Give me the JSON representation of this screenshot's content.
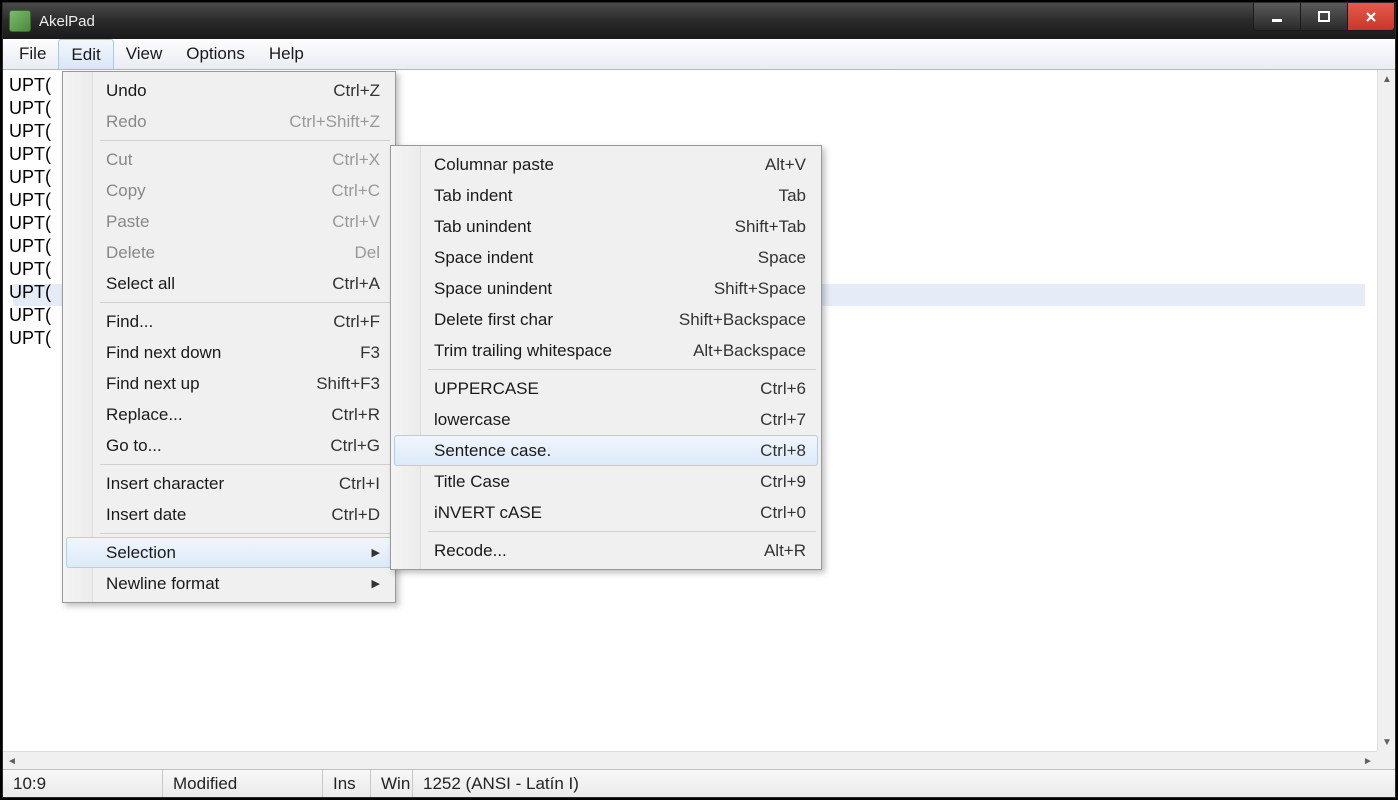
{
  "title": "AkelPad",
  "menubar": {
    "file": "File",
    "edit": "Edit",
    "view": "View",
    "options": "Options",
    "help": "Help"
  },
  "editor": {
    "lines": [
      "UPT(",
      "UPT(",
      "UPT(",
      "UPT(",
      "UPT(",
      "UPT(",
      "UPT(",
      "UPT(",
      "UPT(",
      "UPT(",
      "UPT(",
      "UPT("
    ]
  },
  "editMenu": {
    "undo": {
      "label": "Undo",
      "shortcut": "Ctrl+Z"
    },
    "redo": {
      "label": "Redo",
      "shortcut": "Ctrl+Shift+Z"
    },
    "cut": {
      "label": "Cut",
      "shortcut": "Ctrl+X"
    },
    "copy": {
      "label": "Copy",
      "shortcut": "Ctrl+C"
    },
    "paste": {
      "label": "Paste",
      "shortcut": "Ctrl+V"
    },
    "delete": {
      "label": "Delete",
      "shortcut": "Del"
    },
    "selectAll": {
      "label": "Select all",
      "shortcut": "Ctrl+A"
    },
    "find": {
      "label": "Find...",
      "shortcut": "Ctrl+F"
    },
    "findNextDown": {
      "label": "Find next down",
      "shortcut": "F3"
    },
    "findNextUp": {
      "label": "Find next up",
      "shortcut": "Shift+F3"
    },
    "replace": {
      "label": "Replace...",
      "shortcut": "Ctrl+R"
    },
    "goto": {
      "label": "Go to...",
      "shortcut": "Ctrl+G"
    },
    "insertChar": {
      "label": "Insert character",
      "shortcut": "Ctrl+I"
    },
    "insertDate": {
      "label": "Insert date",
      "shortcut": "Ctrl+D"
    },
    "selection": {
      "label": "Selection"
    },
    "newlineFormat": {
      "label": "Newline format"
    }
  },
  "selectionSubmenu": {
    "columnarPaste": {
      "label": "Columnar paste",
      "shortcut": "Alt+V"
    },
    "tabIndent": {
      "label": "Tab indent",
      "shortcut": "Tab"
    },
    "tabUnindent": {
      "label": "Tab unindent",
      "shortcut": "Shift+Tab"
    },
    "spaceIndent": {
      "label": "Space indent",
      "shortcut": "Space"
    },
    "spaceUnindent": {
      "label": "Space unindent",
      "shortcut": "Shift+Space"
    },
    "deleteFirstChar": {
      "label": "Delete first char",
      "shortcut": "Shift+Backspace"
    },
    "trimTrailing": {
      "label": "Trim trailing whitespace",
      "shortcut": "Alt+Backspace"
    },
    "uppercase": {
      "label": "UPPERCASE",
      "shortcut": "Ctrl+6"
    },
    "lowercase": {
      "label": "lowercase",
      "shortcut": "Ctrl+7"
    },
    "sentenceCase": {
      "label": "Sentence case.",
      "shortcut": "Ctrl+8"
    },
    "titleCase": {
      "label": "Title Case",
      "shortcut": "Ctrl+9"
    },
    "invertCase": {
      "label": "iNVERT cASE",
      "shortcut": "Ctrl+0"
    },
    "recode": {
      "label": "Recode...",
      "shortcut": "Alt+R"
    }
  },
  "status": {
    "position": "10:9",
    "modified": "Modified",
    "insert": "Ins",
    "platform": "Win",
    "encoding": "1252  (ANSI - Latín I)"
  }
}
